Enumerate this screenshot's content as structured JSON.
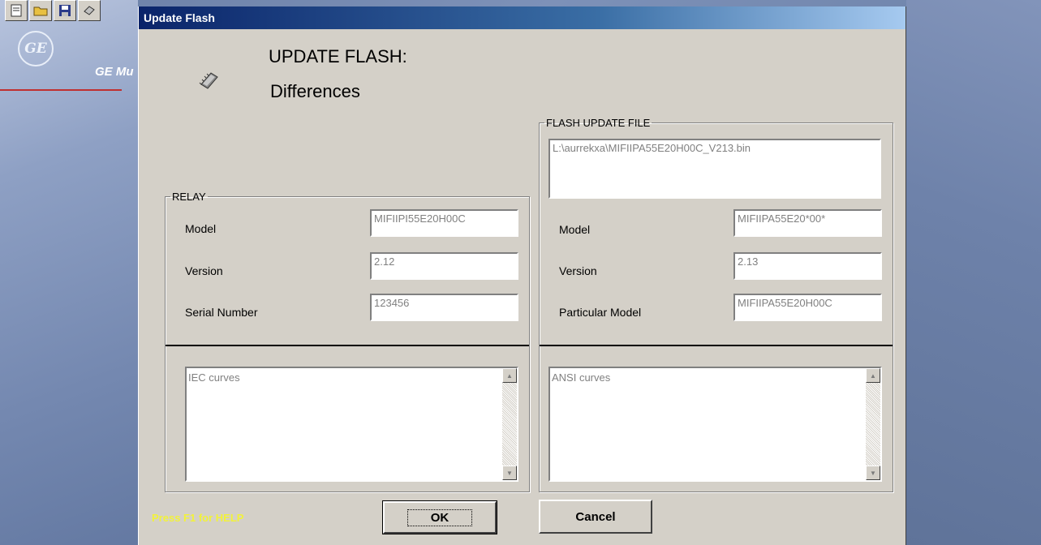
{
  "background": {
    "toolbar_icons": [
      "new-file-icon",
      "open-folder-icon",
      "save-icon",
      "print-icon"
    ],
    "logo_text": "GE",
    "brand_text": "GE Mu",
    "help_text": "Press F1 for HELP"
  },
  "dialog": {
    "title": "Update Flash",
    "heading_line1": "UPDATE FLASH:",
    "heading_line2": "Differences",
    "relay": {
      "legend": "RELAY",
      "model_label": "Model",
      "model_value": "MIFIIPI55E20H00C",
      "version_label": "Version",
      "version_value": "2.12",
      "serial_label": "Serial Number",
      "serial_value": "123456",
      "curves": "IEC curves"
    },
    "file": {
      "legend": "FLASH UPDATE FILE",
      "path": "L:\\aurrekxa\\MIFIIPA55E20H00C_V213.bin",
      "model_label": "Model",
      "model_value": "MIFIIPA55E20*00*",
      "version_label": "Version",
      "version_value": "2.13",
      "particular_label": "Particular Model",
      "particular_value": "MIFIIPA55E20H00C",
      "curves": "ANSI curves"
    },
    "ok_label": "OK",
    "cancel_label": "Cancel"
  }
}
